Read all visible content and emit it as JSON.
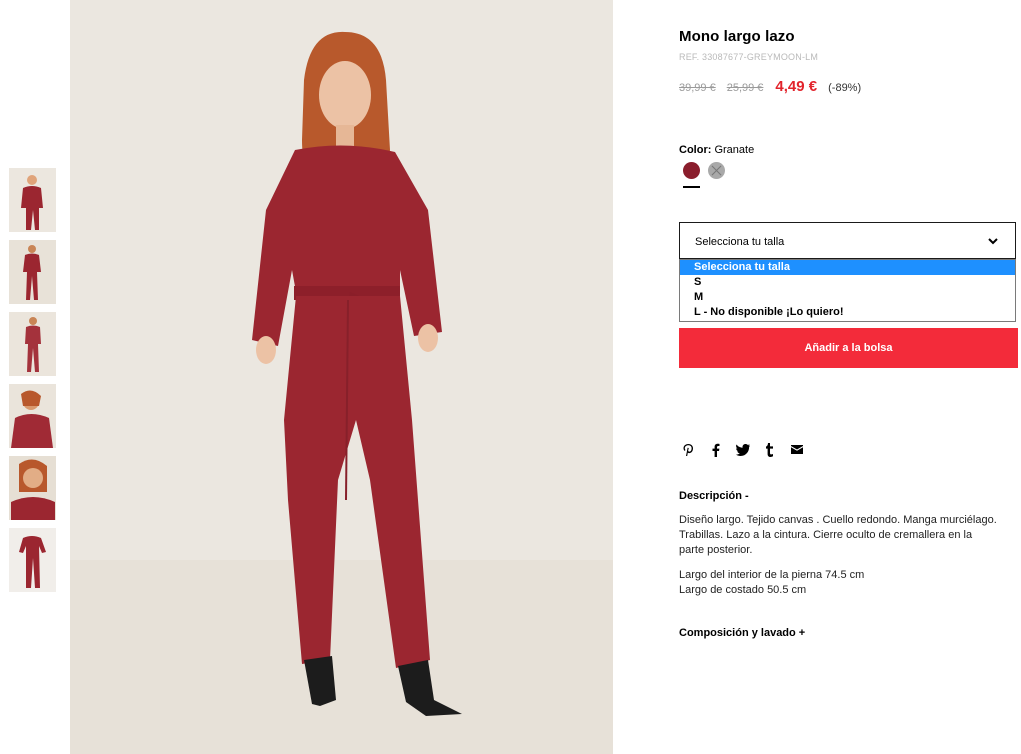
{
  "product": {
    "title": "Mono largo lazo",
    "ref": "REF. 33087677-GREYMOON-LM",
    "prices": {
      "original": "39,99 €",
      "previous": "25,99 €",
      "current": "4,49 €",
      "discount": "(-89%)"
    },
    "color": {
      "label": "Color:",
      "value": "Granate",
      "swatches": [
        "#8a1d2c",
        "#a9a9a9"
      ]
    }
  },
  "size_select": {
    "label": "Selecciona tu talla",
    "options": [
      "Selecciona tu talla",
      "S",
      "M",
      "L - No disponible ¡Lo quiero!"
    ],
    "selected_index": 0
  },
  "add_button": "Añadir a la bolsa",
  "share_icons": [
    "pinterest-icon",
    "facebook-icon",
    "twitter-icon",
    "tumblr-icon",
    "email-icon"
  ],
  "description": {
    "heading": "Descripción -",
    "text1": "Diseño largo. Tejido canvas . Cuello redondo. Manga murciélago. Trabillas. Lazo a la cintura. Cierre oculto de cremallera en la parte posterior.",
    "text2_line1": "Largo del interior de la pierna 74.5 cm",
    "text2_line2": "Largo de costado 50.5 cm"
  },
  "composition_heading": "Composición y lavado +",
  "colors": {
    "accent": "#f32b3a",
    "sale": "#e2242c",
    "selected_option": "#1e90ff",
    "garment": "#9b2630"
  },
  "thumbnails": 6
}
